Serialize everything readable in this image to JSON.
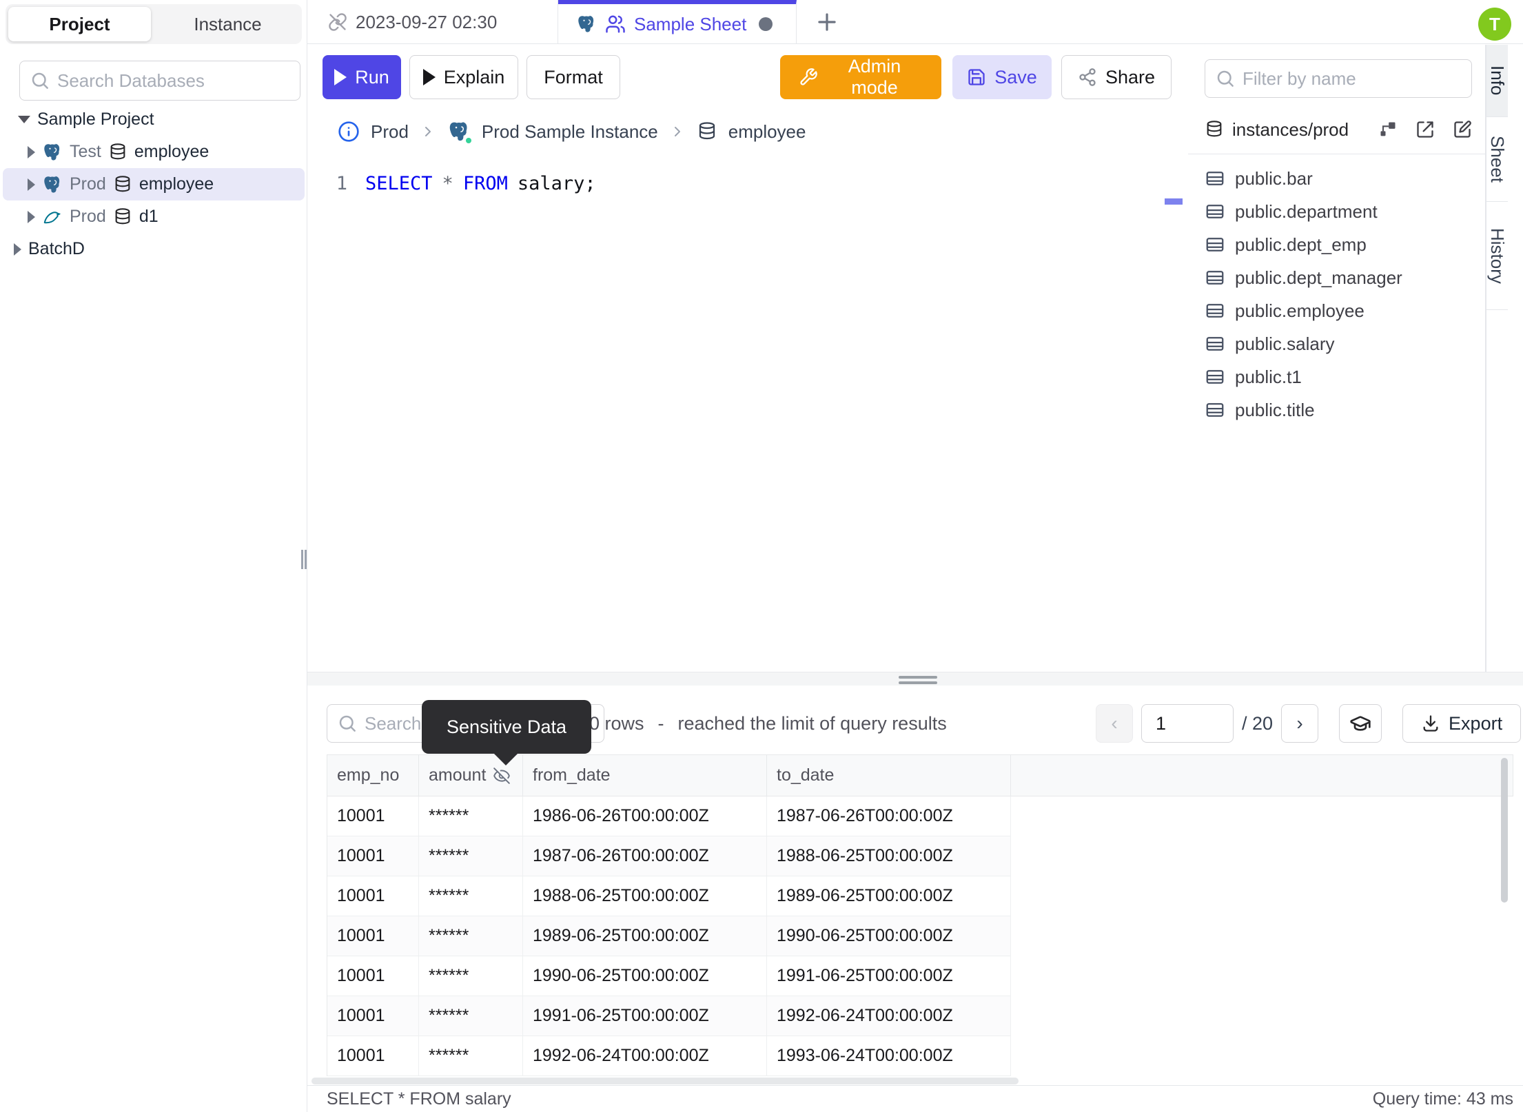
{
  "sidebar": {
    "tabs": [
      "Project",
      "Instance"
    ],
    "search_placeholder": "Search Databases",
    "project_label": "Sample Project",
    "batch_label": "BatchD",
    "items": [
      {
        "env": "Test",
        "db": "employee",
        "engine": "postgres"
      },
      {
        "env": "Prod",
        "db": "employee",
        "engine": "postgres"
      },
      {
        "env": "Prod",
        "db": "d1",
        "engine": "mysql"
      }
    ]
  },
  "tabbar": {
    "tab1": "2023-09-27 02:30",
    "tab2": "Sample Sheet",
    "add": "+",
    "avatar": "T"
  },
  "toolbar": {
    "run": "Run",
    "explain": "Explain",
    "format": "Format",
    "admin": "Admin mode",
    "save": "Save",
    "share": "Share"
  },
  "breadcrumb": {
    "environment": "Prod",
    "instance": "Prod Sample Instance",
    "database": "employee"
  },
  "editor": {
    "line_number": "1",
    "keyword1": "SELECT",
    "star": "*",
    "keyword2": "FROM",
    "rest": "salary;"
  },
  "schema_panel": {
    "filter_placeholder": "Filter by name",
    "header": "instances/prod",
    "tables": [
      "public.bar",
      "public.department",
      "public.dept_emp",
      "public.dept_manager",
      "public.employee",
      "public.salary",
      "public.t1",
      "public.title"
    ]
  },
  "side_tabs": [
    "Info",
    "Sheet",
    "History"
  ],
  "results": {
    "search_placeholder": "Search",
    "tooltip": "Sensitive Data",
    "rows_count": "0 rows",
    "rows_sep": "-",
    "rows_note": "reached the limit of query results",
    "page_value": "1",
    "page_total": "/ 20",
    "prev": "‹",
    "next": "›",
    "export_label": "Export",
    "headers": [
      "emp_no",
      "amount",
      "from_date",
      "to_date"
    ],
    "rows": [
      [
        "10001",
        "******",
        "1986-06-26T00:00:00Z",
        "1987-06-26T00:00:00Z"
      ],
      [
        "10001",
        "******",
        "1987-06-26T00:00:00Z",
        "1988-06-25T00:00:00Z"
      ],
      [
        "10001",
        "******",
        "1988-06-25T00:00:00Z",
        "1989-06-25T00:00:00Z"
      ],
      [
        "10001",
        "******",
        "1989-06-25T00:00:00Z",
        "1990-06-25T00:00:00Z"
      ],
      [
        "10001",
        "******",
        "1990-06-25T00:00:00Z",
        "1991-06-25T00:00:00Z"
      ],
      [
        "10001",
        "******",
        "1991-06-25T00:00:00Z",
        "1992-06-24T00:00:00Z"
      ],
      [
        "10001",
        "******",
        "1992-06-24T00:00:00Z",
        "1993-06-24T00:00:00Z"
      ]
    ]
  },
  "statusbar": {
    "query": "SELECT * FROM salary",
    "time": "Query time: 43 ms"
  }
}
